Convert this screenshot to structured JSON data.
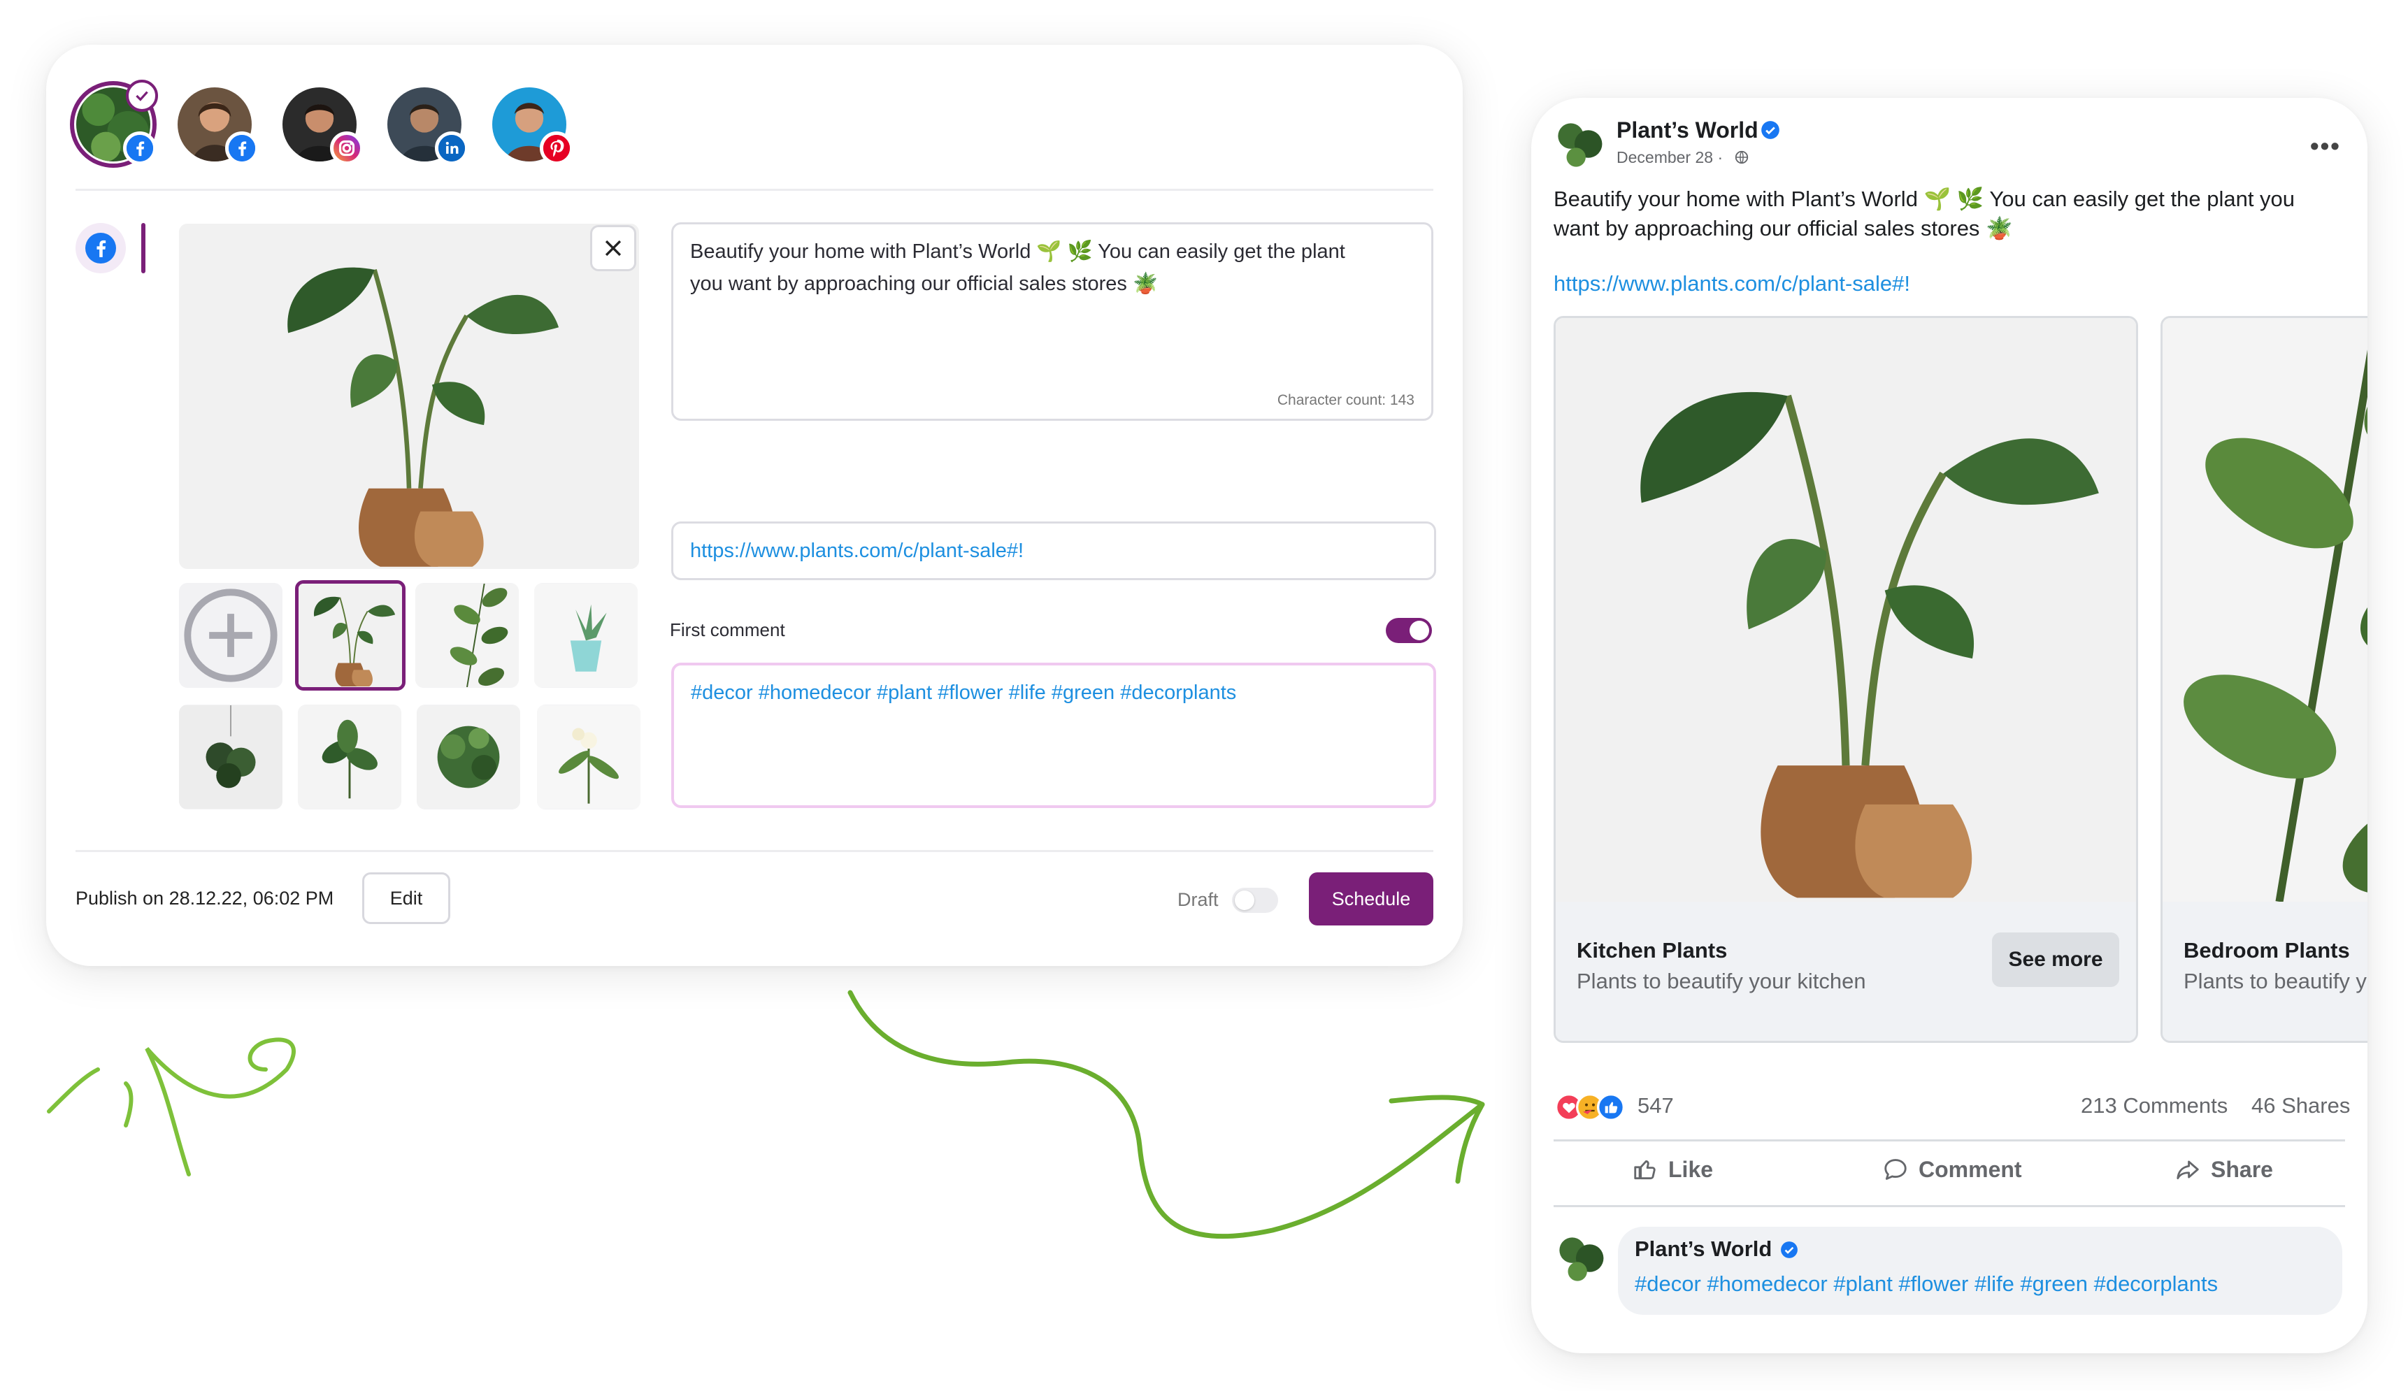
{
  "editor": {
    "accounts": [
      {
        "name": "plants-world",
        "network": "facebook",
        "selected": true
      },
      {
        "name": "account-2",
        "network": "facebook",
        "selected": false
      },
      {
        "name": "account-3",
        "network": "instagram",
        "selected": false
      },
      {
        "name": "account-4",
        "network": "linkedin",
        "selected": false
      },
      {
        "name": "account-5",
        "network": "pinterest",
        "selected": false
      }
    ],
    "post_text": "Beautify your home with Plant’s World 🌱 🌿 You can easily get the plant you want by approaching our official sales stores 🪴",
    "post_text_line1": "Beautify your home with Plant’s World 🌱 🌿 You can easily get the plant",
    "post_text_line2": "you want by approaching our official sales stores 🪴",
    "character_count": "Character count: 143",
    "link": "https://www.plants.com/c/plant-sale#!",
    "first_comment_label": "First comment",
    "first_comment_enabled": true,
    "first_comment_text": "#decor #homedecor #plant #flower #life #green #decorplants",
    "publish_label": "Publish on 28.12.22, 06:02 PM",
    "edit_label": "Edit",
    "draft_label": "Draft",
    "draft_enabled": false,
    "schedule_label": "Schedule"
  },
  "preview": {
    "page_name": "Plant’s World",
    "date": "December 28 ·",
    "text_line1": "Beautify your home with Plant’s World 🌱 🌿 You can easily get the plant you",
    "text_line2": "want by approaching our official sales stores 🪴",
    "link": "https://www.plants.com/c/plant-sale#!",
    "cards": [
      {
        "title": "Kitchen Plants",
        "subtitle": "Plants to beautify your kitchen",
        "button": "See more"
      },
      {
        "title": "Bedroom Plants",
        "subtitle": "Plants to beautify y"
      }
    ],
    "reactions_count": "547",
    "comments": "213 Comments",
    "shares": "46 Shares",
    "actions": {
      "like": "Like",
      "comment": "Comment",
      "share": "Share"
    },
    "comment": {
      "author": "Plant’s World",
      "text": "#decor #homedecor #plant #flower #life #green #decorplants"
    }
  },
  "colors": {
    "brand_purple": "#7a1f78",
    "link_blue": "#1d8fe0",
    "facebook_blue": "#1877f2",
    "arrow_green": "#6aae2e"
  }
}
